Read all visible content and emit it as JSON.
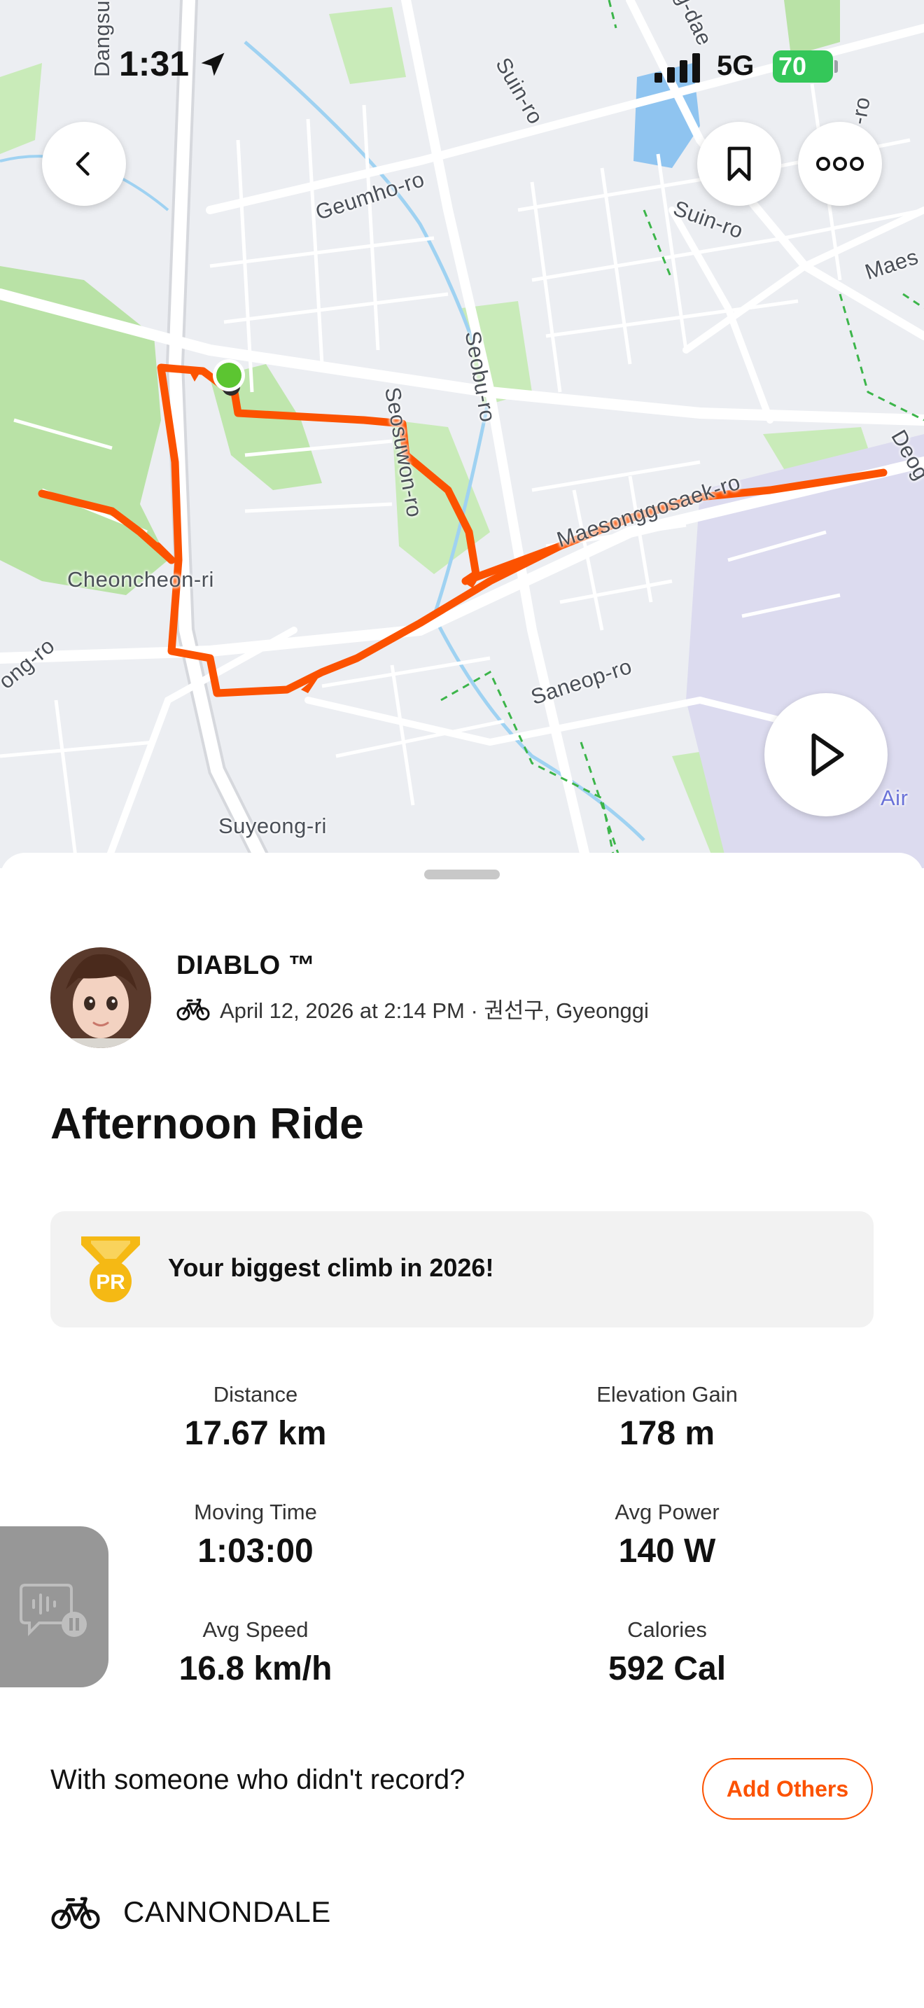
{
  "status_bar": {
    "time": "1:31",
    "network": "5G",
    "battery": "70"
  },
  "map": {
    "labels": {
      "dangsu": "Dangsu",
      "geumho": "Geumho-ro",
      "suin_top": "Suin-ro",
      "suin_right": "Suin-ro",
      "maes": "Maes",
      "seobu": "Seobu-ro",
      "seosuwon": "Seosuwon-ro",
      "cheoncheon": "Cheoncheon-ri",
      "maesonggosaek": "Maesonggosaek-ro",
      "saneop": "Saneop-ro",
      "suyeong": "Suyeong-ri",
      "ong": "ong-ro",
      "deog": "Deog",
      "air": "Air",
      "gdae": "g-dae",
      "ro_top_right": "-ro"
    }
  },
  "activity": {
    "athlete_name": "DIABLO ™",
    "date_location": "April 12, 2026 at 2:14 PM · 권선구, Gyeonggi",
    "title": "Afternoon Ride",
    "achievement_badge": "PR",
    "achievement": "Your biggest climb in 2026!",
    "stats": [
      {
        "label": "Distance",
        "value": "17.67 km"
      },
      {
        "label": "Elevation Gain",
        "value": "178 m"
      },
      {
        "label": "Moving Time",
        "value": "1:03:00"
      },
      {
        "label": "Avg Power",
        "value": "140 W"
      },
      {
        "label": "Avg Speed",
        "value": "16.8 km/h"
      },
      {
        "label": "Calories",
        "value": "592 Cal"
      }
    ],
    "with_others_text": "With someone who didn't record?",
    "add_others_label": "Add Others",
    "gear": "CANNONDALE"
  },
  "colors": {
    "accent": "#fc5200",
    "route": "#fc5200",
    "start": "#5cc531",
    "park": "#b6e4a3"
  },
  "icons": [
    "back-icon",
    "bookmark-icon",
    "more-icon",
    "play-icon",
    "bike-icon",
    "medal-icon",
    "location-arrow-icon",
    "signal-icon"
  ]
}
